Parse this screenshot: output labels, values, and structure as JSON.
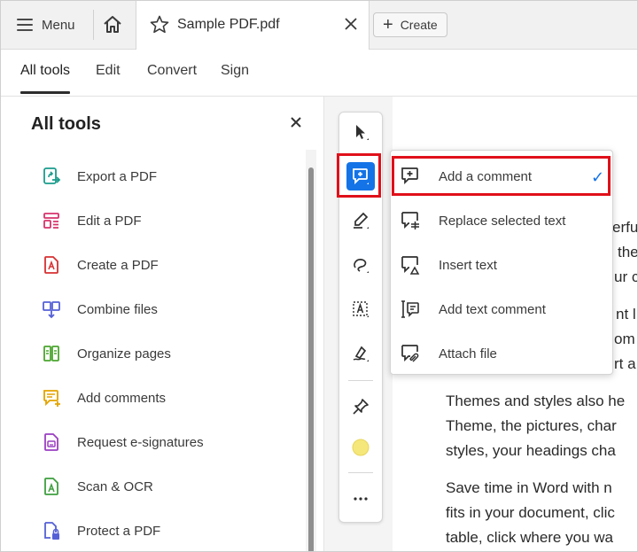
{
  "tabbar": {
    "menu_label": "Menu",
    "doc_tab_name": "Sample PDF.pdf",
    "create_label": "Create"
  },
  "nav": {
    "tabs": [
      "All tools",
      "Edit",
      "Convert",
      "Sign"
    ],
    "active": "All tools"
  },
  "panel": {
    "title": "All tools",
    "items": [
      {
        "label": "Export a PDF",
        "icon": "export-pdf-icon",
        "color": "#1a9c8c"
      },
      {
        "label": "Edit a PDF",
        "icon": "edit-pdf-icon",
        "color": "#d6336c"
      },
      {
        "label": "Create a PDF",
        "icon": "create-pdf-icon",
        "color": "#d63031"
      },
      {
        "label": "Combine files",
        "icon": "combine-files-icon",
        "color": "#5560d6"
      },
      {
        "label": "Organize pages",
        "icon": "organize-pages-icon",
        "color": "#4aa52e"
      },
      {
        "label": "Add comments",
        "icon": "add-comments-icon",
        "color": "#e2a400"
      },
      {
        "label": "Request e-signatures",
        "icon": "request-esignatures-icon",
        "color": "#9a3fc2"
      },
      {
        "label": "Scan & OCR",
        "icon": "scan-ocr-icon",
        "color": "#3e9e3e"
      },
      {
        "label": "Protect a PDF",
        "icon": "protect-pdf-icon",
        "color": "#5560d6"
      }
    ]
  },
  "popup": {
    "items": [
      {
        "label": "Add a comment",
        "icon": "add-comment-icon",
        "checked": true
      },
      {
        "label": "Replace selected text",
        "icon": "replace-text-icon",
        "checked": false
      },
      {
        "label": "Insert text",
        "icon": "insert-text-icon",
        "checked": false
      },
      {
        "label": "Add text comment",
        "icon": "add-text-comment-icon",
        "checked": false
      },
      {
        "label": "Attach file",
        "icon": "attach-file-icon",
        "checked": false
      }
    ],
    "check_mark": "✓"
  },
  "document": {
    "partial_right": [
      "erfu",
      "the",
      "ur c",
      "nt l",
      "om",
      "rt a"
    ],
    "paragraph1": [
      "Themes and styles also he",
      "Theme, the pictures, char",
      "styles, your headings cha"
    ],
    "paragraph2": [
      "Save time in Word with n",
      "fits in your document, clic",
      "table, click where you wa"
    ]
  },
  "colors": {
    "accent": "#1473e6",
    "highlight": "#e0101a",
    "sticky_note": "#f6e77a"
  }
}
